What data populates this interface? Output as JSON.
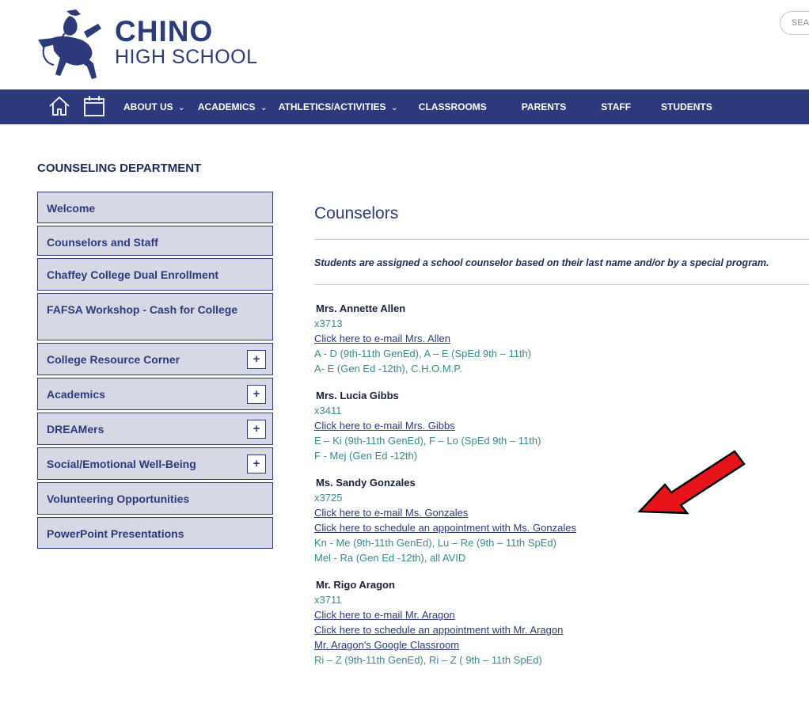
{
  "header": {
    "school_name": "CHINO",
    "school_sub": "HIGH SCHOOL",
    "search_label": "SEA"
  },
  "nav": {
    "color": "#2c3a7b",
    "items": [
      {
        "label": "ABOUT US",
        "dropdown": true
      },
      {
        "label": "ACADEMICS",
        "dropdown": true
      },
      {
        "label": "ATHLETICS/ACTIVITIES",
        "dropdown": true
      },
      {
        "label": "CLASSROOMS",
        "dropdown": false
      },
      {
        "label": "PARENTS",
        "dropdown": false
      },
      {
        "label": "STAFF",
        "dropdown": false
      },
      {
        "label": "STUDENTS",
        "dropdown": false
      }
    ]
  },
  "sidebar": {
    "title": "COUNSELING DEPARTMENT",
    "items": [
      {
        "label": "Welcome",
        "expandable": false
      },
      {
        "label": "Counselors and Staff",
        "expandable": false
      },
      {
        "label": "Chaffey College Dual Enrollment",
        "expandable": false
      },
      {
        "label": "FAFSA Workshop - Cash for College",
        "expandable": false
      },
      {
        "label": "College Resource Corner",
        "expandable": true
      },
      {
        "label": "Academics",
        "expandable": true
      },
      {
        "label": "DREAMers",
        "expandable": true
      },
      {
        "label": "Social/Emotional Well-Being",
        "expandable": true
      },
      {
        "label": "Volunteering Opportunities",
        "expandable": false
      },
      {
        "label": "PowerPoint Presentations",
        "expandable": false
      }
    ],
    "plus_symbol": "+"
  },
  "main": {
    "title": "Counselors",
    "intro": "Students are assigned a school counselor based on their last name and/or by a special program.",
    "counselors": [
      {
        "name": "Mrs. Annette Allen",
        "ext": "x3713",
        "links": [
          "Click here to e-mail Mrs. Allen"
        ],
        "assignments": [
          "A - D (9th-11th GenEd), A – E (SpEd 9th – 11th)",
          "A- E (Gen Ed -12th), C.H.O.M.P."
        ]
      },
      {
        "name": "Mrs. Lucia Gibbs",
        "ext": "x3411",
        "links": [
          "Click here to e-mail Mrs. Gibbs"
        ],
        "assignments": [
          "E – Ki (9th-11th GenEd), F – Lo (SpEd 9th – 11th)",
          "F - Mej (Gen Ed -12th)"
        ]
      },
      {
        "name": "Ms. Sandy Gonzales",
        "ext": "x3725",
        "links": [
          "Click here to e-mail Ms. Gonzales",
          "Click here to schedule an appointment with Ms. Gonzales"
        ],
        "assignments": [
          "Kn - Me (9th-11th GenEd), Lu – Re (9th – 11th SpEd)",
          "Mel - Ra (Gen Ed -12th), all AVID"
        ]
      },
      {
        "name": "Mr. Rigo Aragon",
        "ext": "x3711",
        "links": [
          "Click here to e-mail Mr. Aragon",
          "Click here to schedule an appointment with Mr. Aragon",
          "Mr. Aragon's Google Classroom"
        ],
        "assignments": [
          "Ri – Z (9th-11th GenEd), Ri – Z ( 9th – 11th SpEd)"
        ]
      }
    ]
  },
  "annotation": {
    "color": "#e8141c"
  }
}
